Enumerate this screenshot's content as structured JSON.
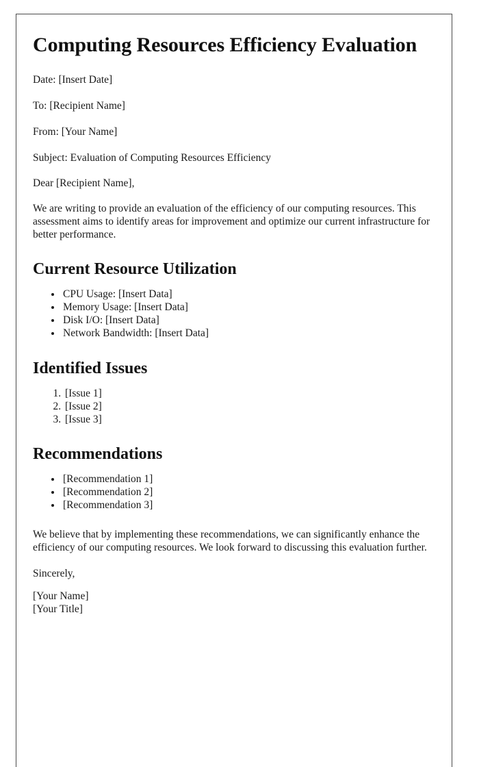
{
  "document": {
    "title": "Computing Resources Efficiency Evaluation",
    "meta": {
      "date_line": "Date: [Insert Date]",
      "to_line": "To: [Recipient Name]",
      "from_line": "From: [Your Name]",
      "subject_line": "Subject: Evaluation of Computing Resources Efficiency",
      "salutation": "Dear [Recipient Name],"
    },
    "intro_paragraph": "We are writing to provide an evaluation of the efficiency of our computing resources. This assessment aims to identify areas for improvement and optimize our current infrastructure for better performance.",
    "sections": [
      {
        "heading": "Current Resource Utilization",
        "list_type": "bullet",
        "items": [
          "CPU Usage: [Insert Data]",
          "Memory Usage: [Insert Data]",
          "Disk I/O: [Insert Data]",
          "Network Bandwidth: [Insert Data]"
        ]
      },
      {
        "heading": "Identified Issues",
        "list_type": "number",
        "items": [
          "[Issue 1]",
          "[Issue 2]",
          "[Issue 3]"
        ]
      },
      {
        "heading": "Recommendations",
        "list_type": "bullet",
        "items": [
          "[Recommendation 1]",
          "[Recommendation 2]",
          "[Recommendation 3]"
        ]
      }
    ],
    "closing_paragraph": "We believe that by implementing these recommendations, we can significantly enhance the efficiency of our computing resources. We look forward to discussing this evaluation further.",
    "signoff": "Sincerely,",
    "signature_name": "[Your Name]",
    "signature_title": "[Your Title]"
  },
  "colors": {
    "page_background": "#ffffff",
    "text": "#1a1a1a",
    "heading_text": "#111111",
    "page_border": "#4a4a4a"
  }
}
